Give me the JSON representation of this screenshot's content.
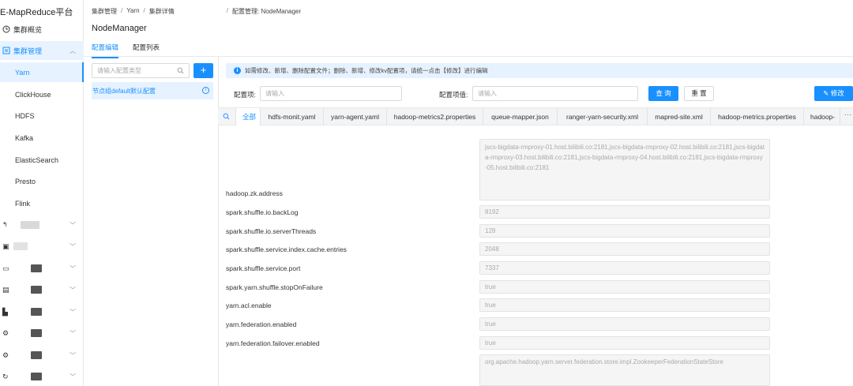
{
  "app": {
    "title": "E-MapReduce平台"
  },
  "sidebar": {
    "overview": "集群概览",
    "cluster_mgmt": "集群管理",
    "sub_items": [
      "Yarn",
      "ClickHouse",
      "HDFS",
      "Kafka",
      "ElasticSearch",
      "Presto",
      "Flink"
    ],
    "active_sub": "Yarn"
  },
  "header": {
    "breadcrumb": [
      "集群管理",
      "Yarn",
      "集群详情",
      "配置管理: NodeManager"
    ],
    "page_title": "NodeManager",
    "tabs": [
      "配置编辑",
      "配置列表"
    ]
  },
  "groups": {
    "search_placeholder": "请输入配置类型",
    "add_label": "+",
    "items": [
      "节点组default默认配置"
    ]
  },
  "notice": "如需修改、新增、删除配置文件；删除、新增、修改kv配置项，请统一点击【修改】进行编辑",
  "filters": {
    "item_label": "配置项:",
    "item_placeholder": "请输入",
    "value_label": "配置项值:",
    "value_placeholder": "请输入",
    "query": "查 询",
    "reset": "重 置",
    "edit": "修改"
  },
  "file_tabs": [
    "全部",
    "hdfs-monit.yaml",
    "yarn-agent.yaml",
    "hadoop-metrics2.properties",
    "queue-mapper.json",
    "ranger-yarn-security.xml",
    "mapred-site.xml",
    "hadoop-metrics.properties",
    "hadoop-"
  ],
  "active_file_tab": "全部",
  "config_rows": [
    {
      "key": "hadoop.zk.address",
      "value": "jscs-bigdata-rmproxy-01.host.bilibili.co:2181,jscs-bigdata-rmproxy-02.host.bilibili.co:2181,jscs-bigdata-rmproxy-03.host.bilibili.co:2181,jscs-bigdata-rmproxy-04.host.bilibili.co:2181,jscs-bigdata-rmproxy-05.host.bilibili.co:2181"
    },
    {
      "key": "spark.shuffle.io.backLog",
      "value": "8192"
    },
    {
      "key": "spark.shuffle.io.serverThreads",
      "value": "128"
    },
    {
      "key": "spark.shuffle.service.index.cache.entries",
      "value": "2048"
    },
    {
      "key": "spark.shuffle.service.port",
      "value": "7337"
    },
    {
      "key": "spark.yarn.shuffle.stopOnFailure",
      "value": "true"
    },
    {
      "key": "yarn.acl.enable",
      "value": "true"
    },
    {
      "key": "yarn.federation.enabled",
      "value": "true"
    },
    {
      "key": "yarn.federation.failover.enabled",
      "value": "true"
    },
    {
      "key": "",
      "value": "org.apache.hadoop.yarn.server.federation.store.impl.ZookeeperFederationStateStore"
    }
  ]
}
